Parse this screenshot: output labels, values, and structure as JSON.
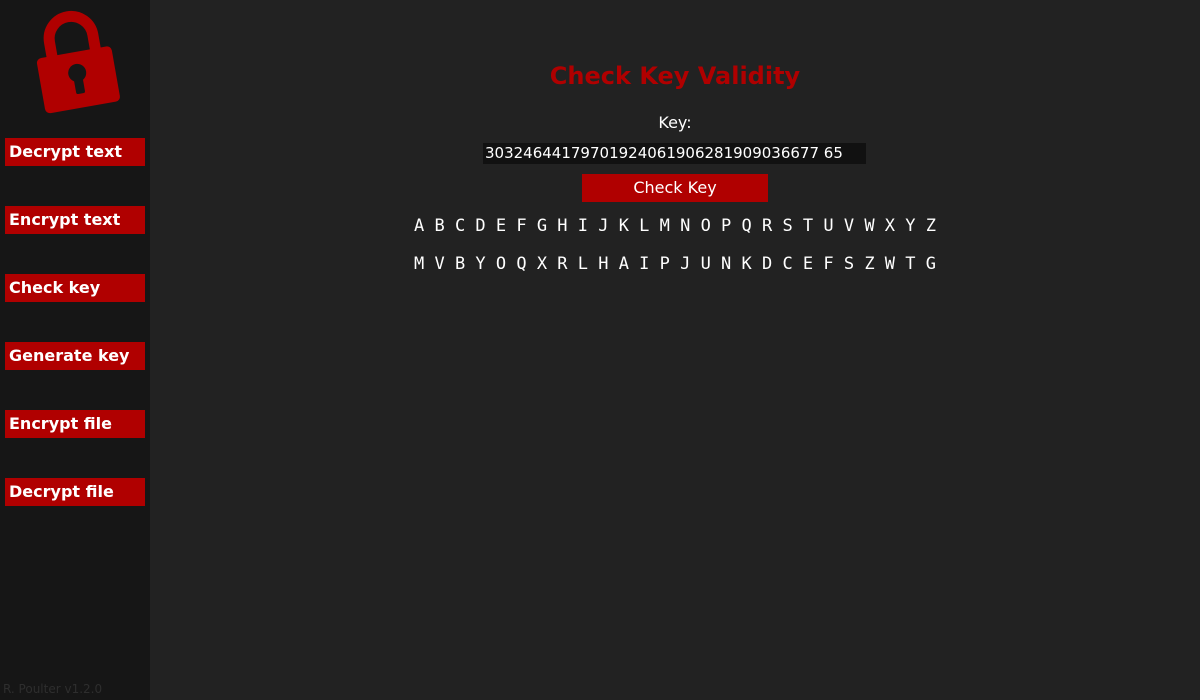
{
  "sidebar": {
    "logo_icon": "padlock-icon",
    "items": [
      {
        "label": "Decrypt text"
      },
      {
        "label": "Encrypt text"
      },
      {
        "label": "Check key"
      },
      {
        "label": "Generate key"
      },
      {
        "label": "Encrypt file"
      },
      {
        "label": "Decrypt file"
      }
    ],
    "version": "R. Poulter v1.2.0"
  },
  "main": {
    "title": "Check Key Validity",
    "key_label": "Key:",
    "key_value": "30324644179701924061906281909036677 65",
    "check_button": "Check Key",
    "plain_alphabet": "A B C D E F G H I J K L M N O P Q R S T U V W X Y Z",
    "cipher_alphabet": "M V B Y O Q X R L H A I P J U N K D C E F S Z W T G"
  },
  "colors": {
    "accent": "#b00000",
    "background": "#222222",
    "sidebar": "#161616",
    "text": "#ffffff"
  }
}
